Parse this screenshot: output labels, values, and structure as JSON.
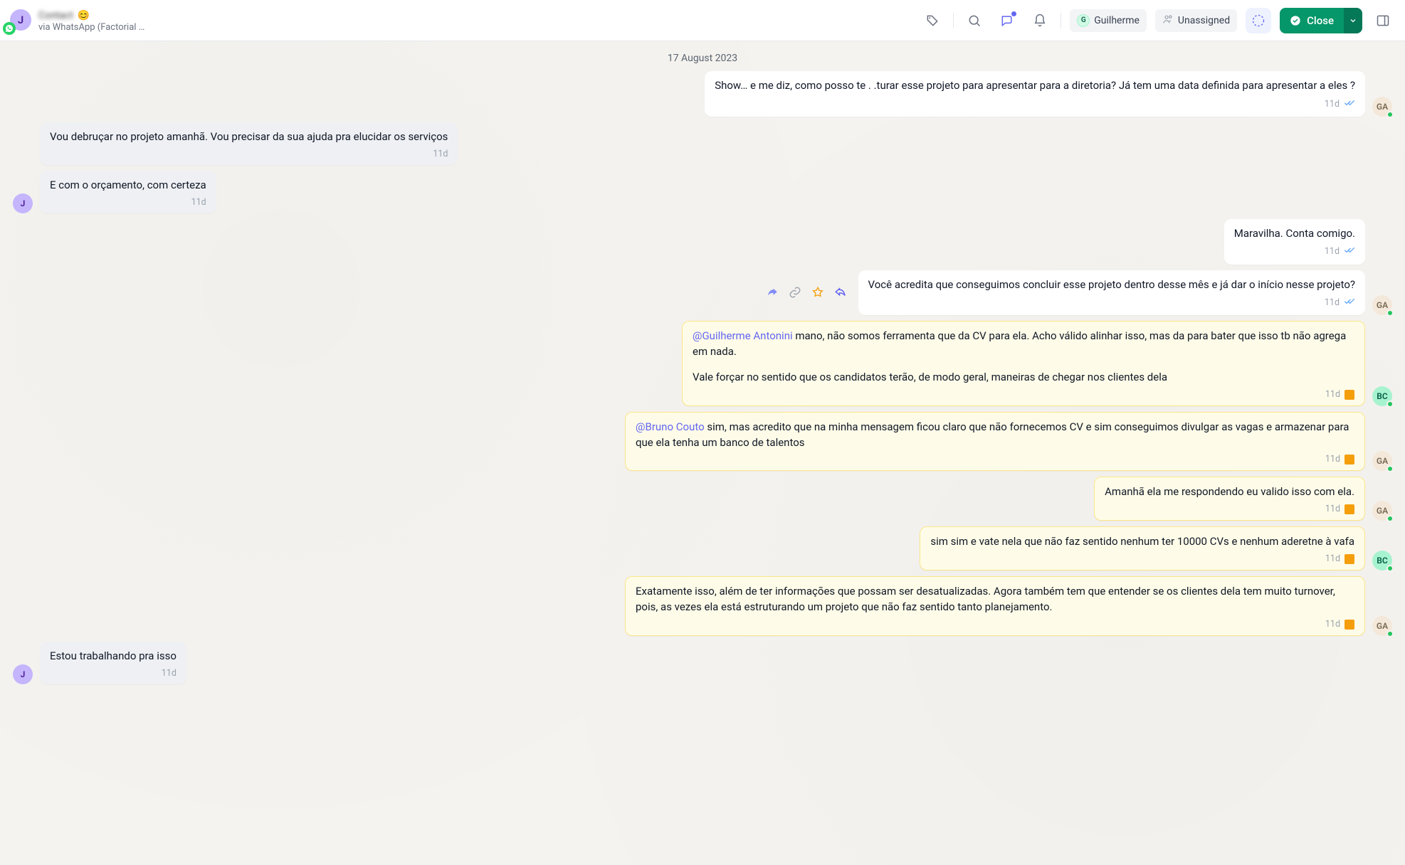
{
  "header": {
    "contact_initial": "J",
    "contact_name": "Contact",
    "contact_emoji": "😊",
    "via_line": "via WhatsApp (Factorial …",
    "assignee": {
      "initial": "G",
      "name": "Guilherme"
    },
    "team": "Unassigned",
    "close_label": "Close"
  },
  "date_separator": "17 August 2023",
  "messages": {
    "m1": {
      "text": "Show… e me diz, como posso te .            .turar esse projeto para apresentar para a diretoria? Já tem uma data definida para apresentar a eles ?",
      "time": "11d"
    },
    "m2": {
      "text": "Vou debruçar no projeto amanhã. Vou precisar da sua ajuda pra elucidar os serviços",
      "time": "11d"
    },
    "m3": {
      "text": "E com o orçamento, com certeza",
      "time": "11d"
    },
    "m4": {
      "text": "Maravilha. Conta comigo.",
      "time": "11d"
    },
    "m5": {
      "text": "Você acredita que conseguimos concluir esse projeto dentro desse mês e já dar o início nesse projeto?",
      "time": "11d"
    },
    "m6": {
      "mention": "@Guilherme Antonini",
      "text1": " mano, não somos ferramenta que da CV para ela. Acho válido alinhar isso, mas da para bater que isso tb não agrega em nada.",
      "text2": "Vale forçar no sentido que os candidatos terão, de modo geral, maneiras de chegar nos clientes dela",
      "time": "11d"
    },
    "m7": {
      "mention": "@Bruno Couto",
      "text": " sim, mas acredito que na minha mensagem ficou claro que não fornecemos CV e sim conseguimos divulgar as vagas e armazenar para que ela tenha um banco de talentos",
      "time": "11d"
    },
    "m8": {
      "text": "Amanhã ela me respondendo eu valido isso com ela.",
      "time": "11d"
    },
    "m9": {
      "text": "sim sim e vate nela que não faz sentido nenhum ter 10000 CVs e nenhum aderetne à vafa",
      "time": "11d"
    },
    "m10": {
      "text": "Exatamente isso, além de ter informações que possam ser desatualizadas. Agora também tem que entender se os clientes dela tem muito turnover, pois, as vezes ela está estruturando um projeto que não faz sentido tanto planejamento.",
      "time": "11d"
    },
    "m11": {
      "text": "Estou trabalhando pra isso",
      "time": "11d"
    }
  },
  "avatars": {
    "J": "J",
    "GA": "GA",
    "BC": "BC"
  },
  "colors": {
    "close_btn": "#059669",
    "note_bg": "#FEFCE8",
    "mention": "#6366F1"
  }
}
